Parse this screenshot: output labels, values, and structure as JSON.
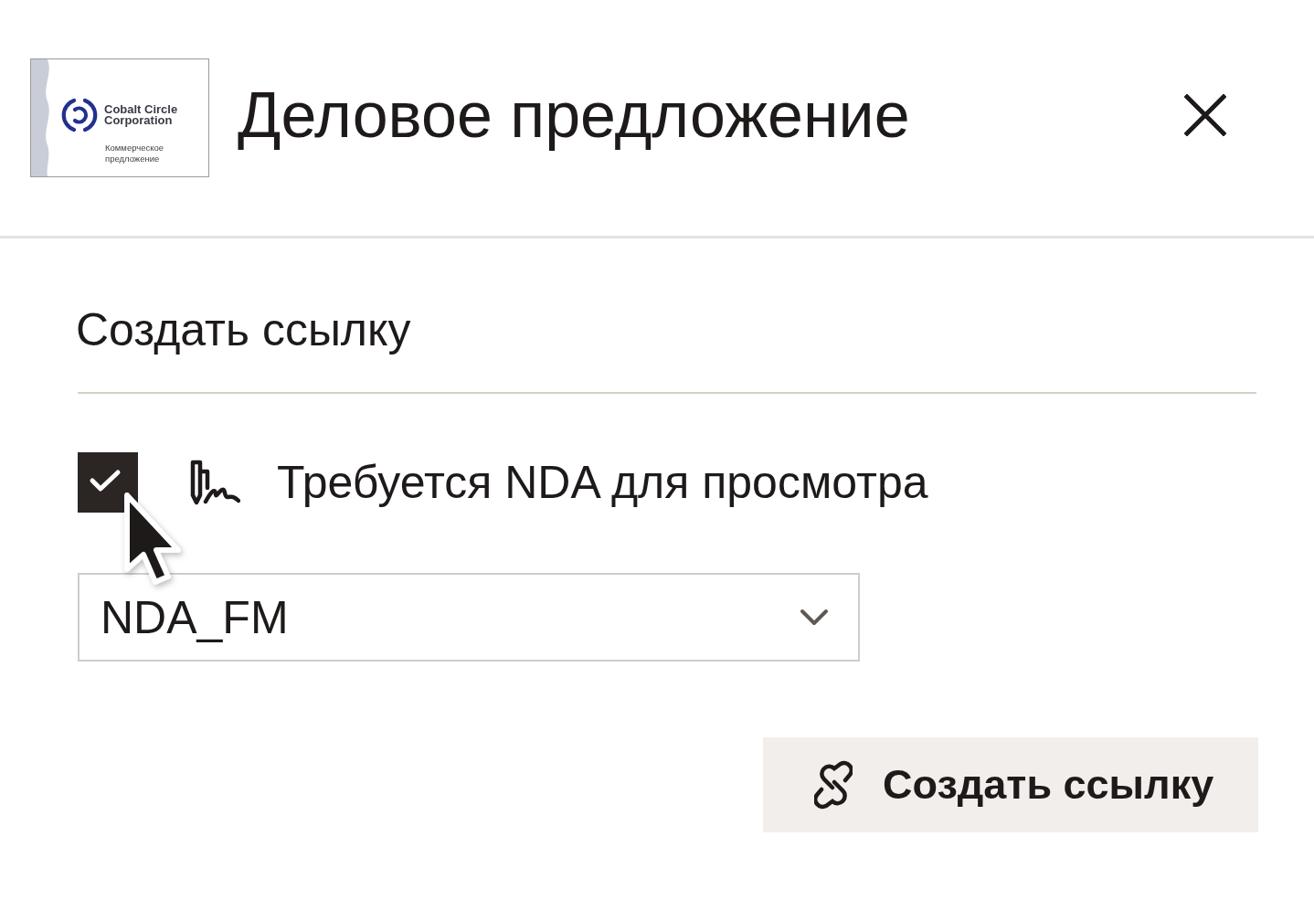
{
  "header": {
    "thumbnail": {
      "company": "Cobalt Circle Corporation",
      "caption": "Коммерческое предложение"
    },
    "title": "Деловое предложение"
  },
  "section": {
    "title": "Создать ссылку"
  },
  "nda_option": {
    "label": "Требуется NDA для просмотра",
    "checked": true
  },
  "nda_select": {
    "value": "NDA_FM"
  },
  "create_button": {
    "label": "Создать ссылку"
  }
}
